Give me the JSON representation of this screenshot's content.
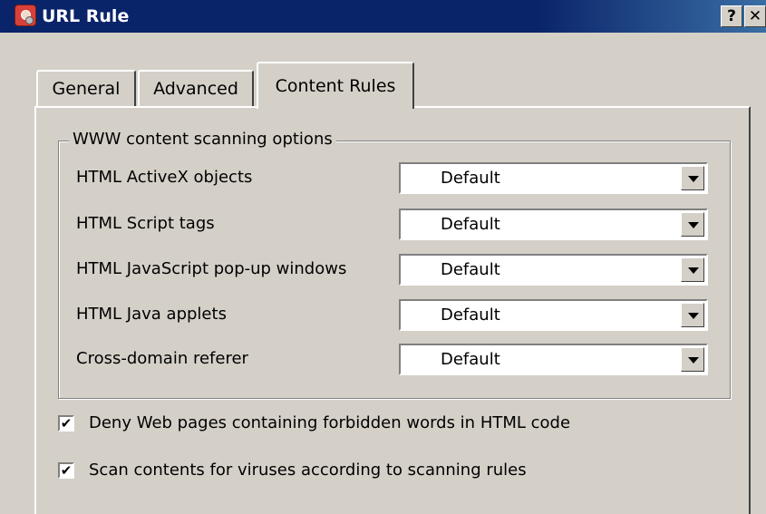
{
  "window": {
    "title": "URL Rule",
    "help_label": "?",
    "close_label": "✕"
  },
  "tabs": [
    {
      "label": "General"
    },
    {
      "label": "Advanced"
    },
    {
      "label": "Content Rules",
      "selected": true
    }
  ],
  "group": {
    "title": "WWW content scanning options",
    "rows": [
      {
        "label": "HTML ActiveX objects",
        "value": "Default"
      },
      {
        "label": "HTML Script tags",
        "value": "Default"
      },
      {
        "label": "HTML JavaScript pop-up windows",
        "value": "Default"
      },
      {
        "label": "HTML Java applets",
        "value": "Default"
      },
      {
        "label": "Cross-domain referer",
        "value": "Default"
      }
    ]
  },
  "checkboxes": [
    {
      "label": "Deny Web pages containing forbidden words in HTML code",
      "checked": true,
      "mark": "✔"
    },
    {
      "label": "Scan contents for viruses according to scanning rules",
      "checked": true,
      "mark": "✔"
    }
  ]
}
